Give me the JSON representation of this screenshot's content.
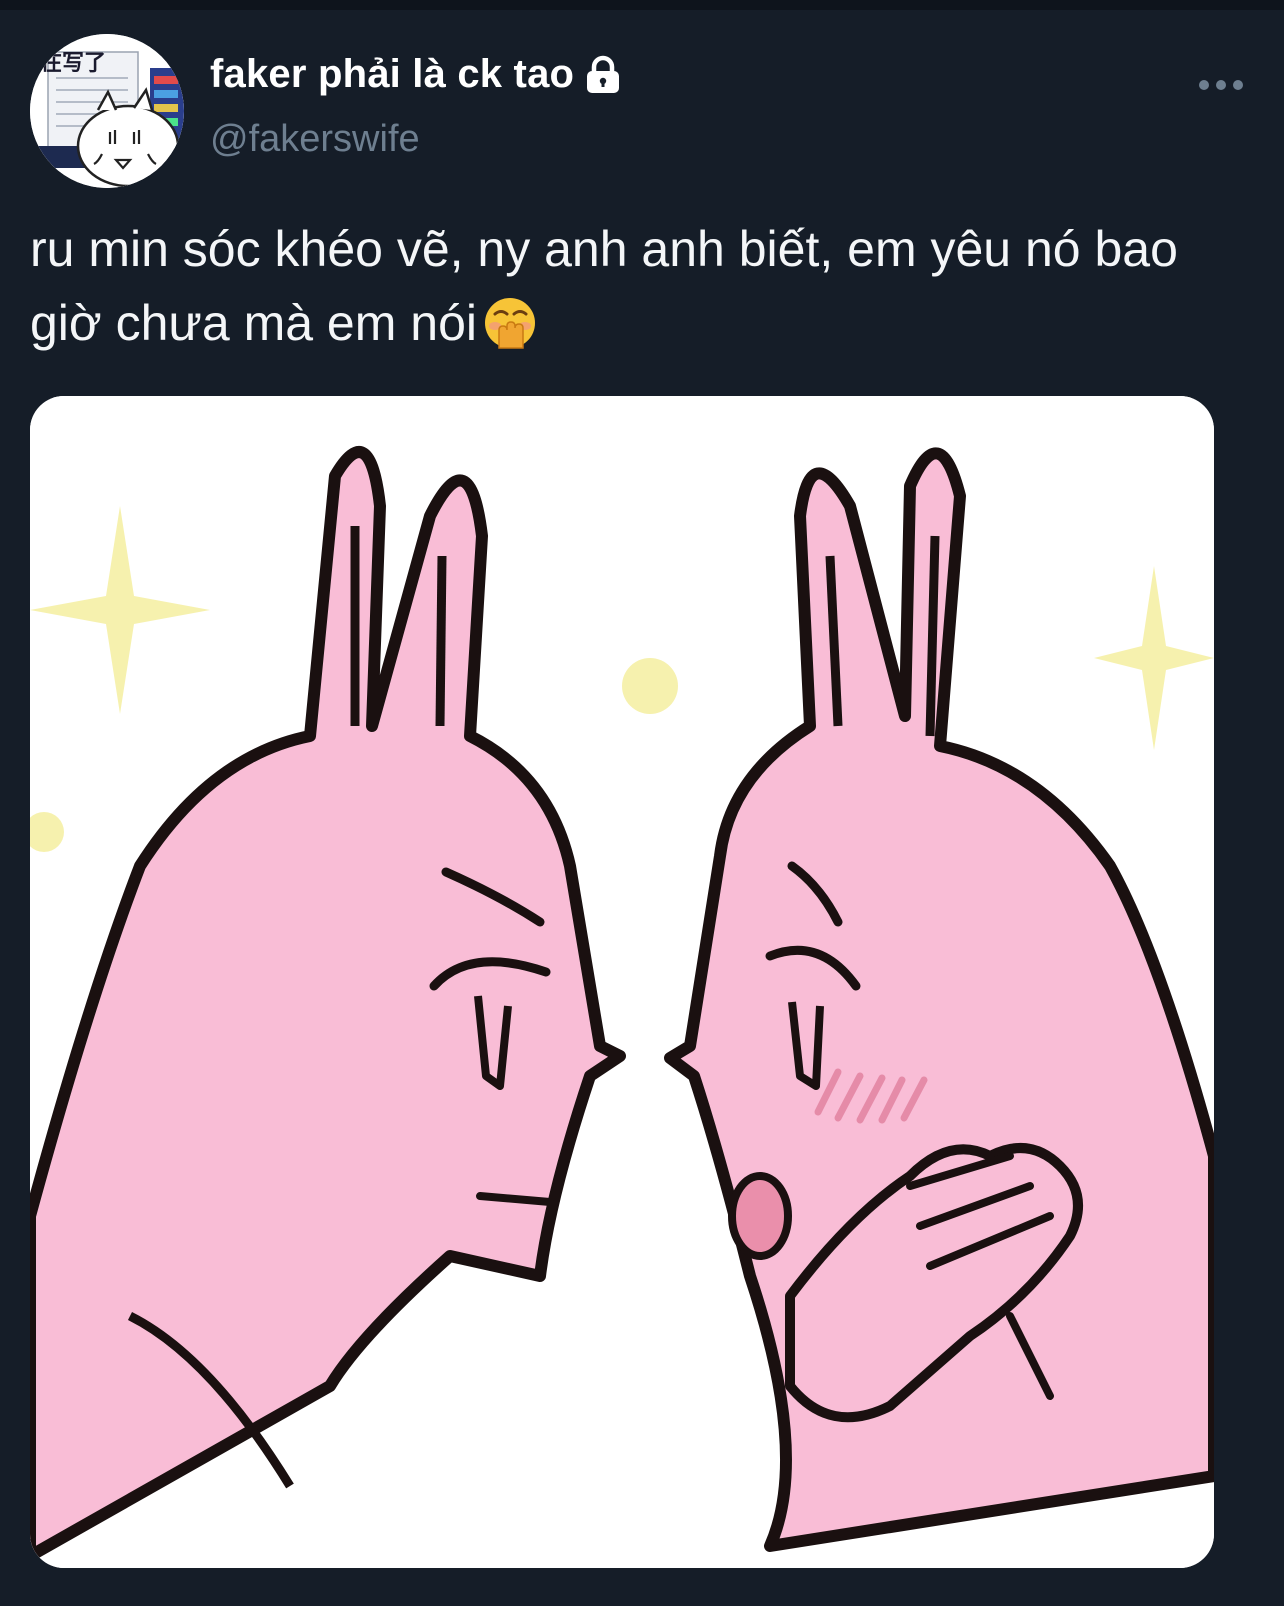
{
  "tweet": {
    "display_name": "faker phải là ck tao",
    "handle": "@fakerswife",
    "text": "ru min sóc khéo vẽ, ny anh anh biết, em yêu nó bao giờ chưa mà em nói",
    "emoji": "face-with-hand-over-mouth",
    "protected_icon": "lock-icon",
    "more_icon": "more-horizontal-icon",
    "avatar_text": "在写了"
  },
  "colors": {
    "background": "#151d28",
    "handle_gray": "#6e7f90",
    "bunny_pink": "#f9bdd6",
    "outline": "#1a1010"
  }
}
